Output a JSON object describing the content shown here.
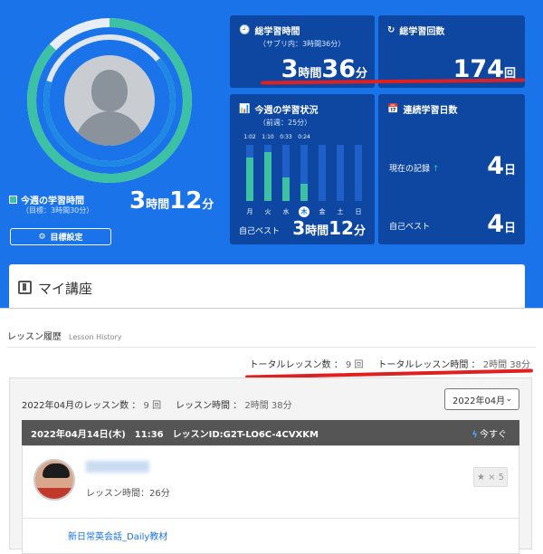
{
  "profile": {
    "today_marker": "木",
    "this_week_label": "今週の学習時間",
    "this_week_goal": "（目標：3時間30分）",
    "this_week_hours": "3",
    "this_week_minutes": "12",
    "unit_hour": "時間",
    "unit_minute": "分",
    "goal_button": "目標設定"
  },
  "total_time": {
    "title": "総学習時間",
    "subtitle": "（サブリ内：3時間36分）",
    "hours": "3",
    "minutes": "36"
  },
  "total_count": {
    "title": "総学習回数",
    "value": "174",
    "unit": "回"
  },
  "weekly": {
    "title": "今週の学習状況",
    "subtitle": "（前週：25分）",
    "best_label": "自己ベスト",
    "best_hours": "3",
    "best_minutes": "12"
  },
  "streak": {
    "title": "連続学習日数",
    "current_label": "現在の記録",
    "current_value": "4",
    "best_label": "自己ベスト",
    "best_value": "4",
    "unit": "日"
  },
  "my_course": {
    "title": "マイ講座"
  },
  "history": {
    "title": "レッスン履歴",
    "title_en": "Lesson History",
    "total_lessons_label": "トータルレッスン数 ：",
    "total_lessons_value": "9 回",
    "total_time_label": "トータルレッスン時間 ：",
    "total_time_value": "2時間 38分",
    "month_lessons_label": "2022年04月のレッスン数 ：",
    "month_lessons_value": "9 回",
    "month_time_label": "レッスン時間 ：",
    "month_time_value": "2時間 38分",
    "month_select": "2022年04月",
    "lesson_header": "2022年04月14日(木)　11:36　レッスンID:G2T-LO6C-4CVXKM",
    "now_label": "今すぐ",
    "lesson_time": "レッスン時間：26分",
    "rating": "★ × 5",
    "material": "新日常英会話_Daily教材"
  },
  "chart_data": {
    "type": "bar",
    "categories": [
      "月",
      "火",
      "水",
      "木",
      "金",
      "土",
      "日"
    ],
    "values": [
      62,
      70,
      33,
      24,
      0,
      0,
      0
    ],
    "value_labels": [
      "1:02",
      "1:10",
      "0:33",
      "0:24",
      "",
      "",
      ""
    ],
    "ylim": [
      0,
      80
    ],
    "colors": {
      "done": "#3cc1a4",
      "remaining": "#1e5fc8",
      "today": "#1a73e8"
    }
  }
}
